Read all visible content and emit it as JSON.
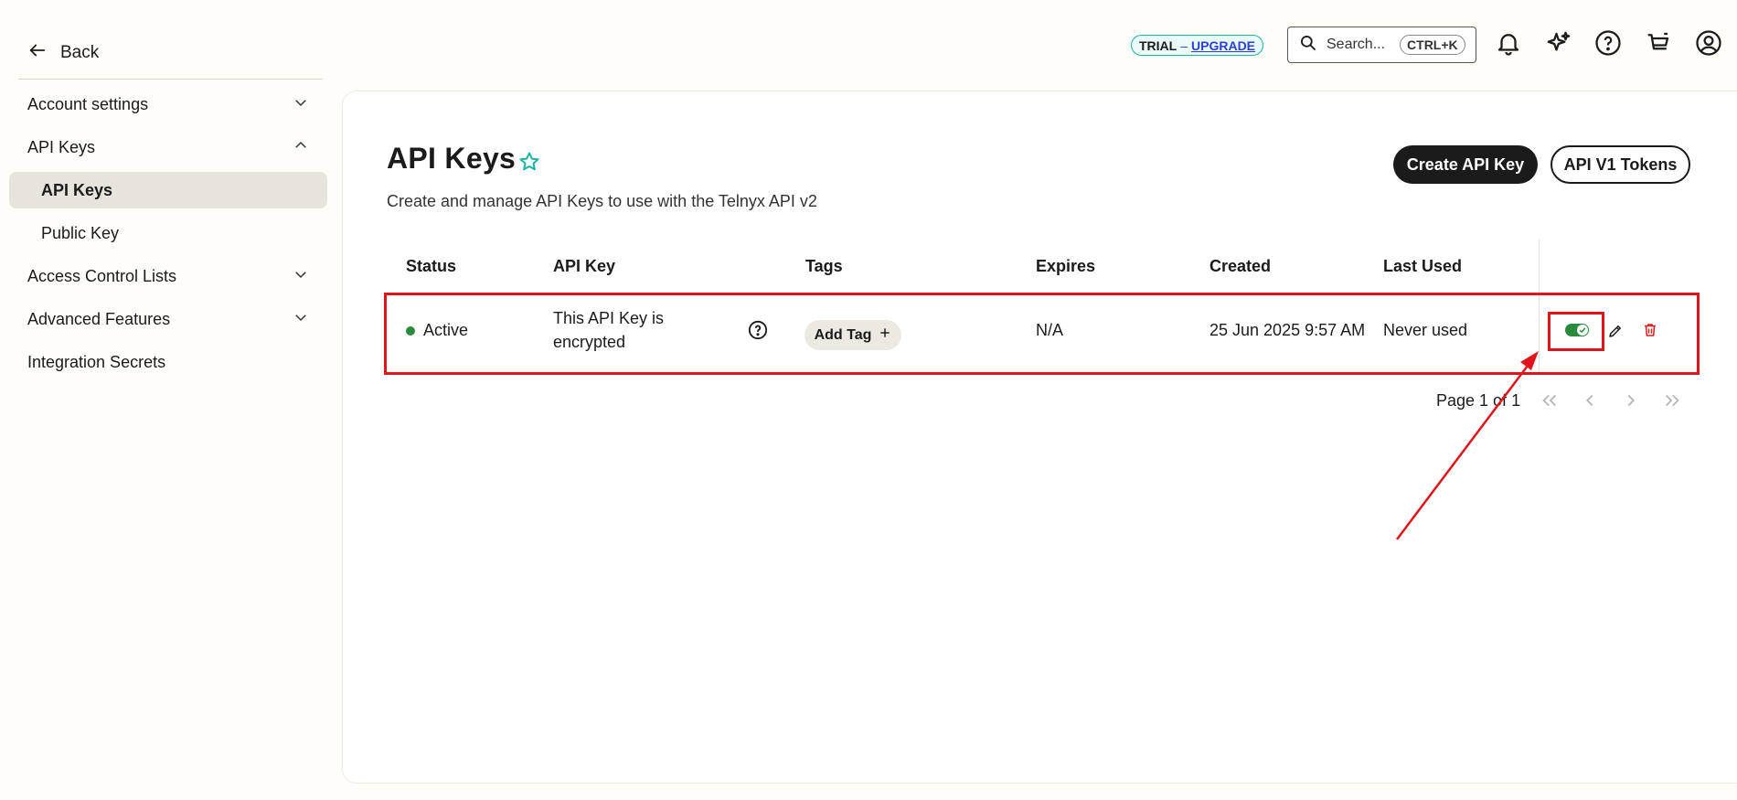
{
  "sidebar": {
    "back_label": "Back",
    "items": [
      {
        "label": "Account settings"
      },
      {
        "label": "API Keys"
      },
      {
        "label": "API Keys"
      },
      {
        "label": "Public Key"
      },
      {
        "label": "Access Control Lists"
      },
      {
        "label": "Advanced Features"
      },
      {
        "label": "Integration Secrets"
      }
    ]
  },
  "topbar": {
    "trial_label": "TRIAL",
    "trial_sep": "–",
    "upgrade_label": "UPGRADE",
    "search_placeholder": "Search...",
    "search_shortcut": "CTRL+K"
  },
  "page": {
    "title": "API Keys",
    "subtitle": "Create and manage API Keys to use with the Telnyx API v2",
    "create_button": "Create API Key",
    "v1_button": "API V1 Tokens"
  },
  "table": {
    "headers": [
      "Status",
      "API Key",
      "Tags",
      "Expires",
      "Created",
      "Last Used"
    ],
    "rows": [
      {
        "status": "Active",
        "api_key_line1": "This API Key is",
        "api_key_line2": "encrypted",
        "tag_button": "Add Tag",
        "expires": "N/A",
        "created": "25 Jun 2025 9:57 AM",
        "last_used": "Never used",
        "enabled": true
      }
    ]
  },
  "pagination": {
    "text": "Page 1 of 1"
  },
  "colors": {
    "accent": "#19b3a5",
    "status_active": "#2a8a3c",
    "annotation": "#e2141b",
    "delete": "#d32020"
  }
}
